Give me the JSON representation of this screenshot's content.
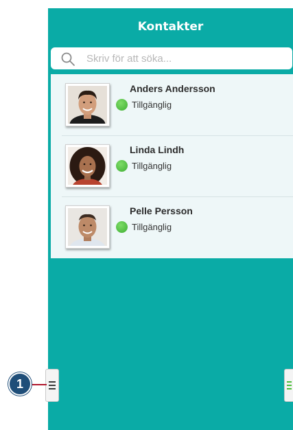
{
  "header": {
    "title": "Kontakter"
  },
  "search": {
    "placeholder": "Skriv för att söka..."
  },
  "contacts": [
    {
      "name": "Anders Andersson",
      "status": "Tillgänglig"
    },
    {
      "name": "Linda Lindh",
      "status": "Tillgänglig"
    },
    {
      "name": "Pelle Persson",
      "status": "Tillgänglig"
    }
  ],
  "callout": {
    "number": "1"
  },
  "icons": {
    "search": "search-icon",
    "menu_left": "menu-icon",
    "menu_right": "menu-icon"
  },
  "colors": {
    "app_background": "#0aaba6",
    "list_background": "#eef7f8",
    "status_available": "#4cbf3a",
    "callout_badge": "#1f4e79",
    "callout_line": "#b0142a"
  }
}
